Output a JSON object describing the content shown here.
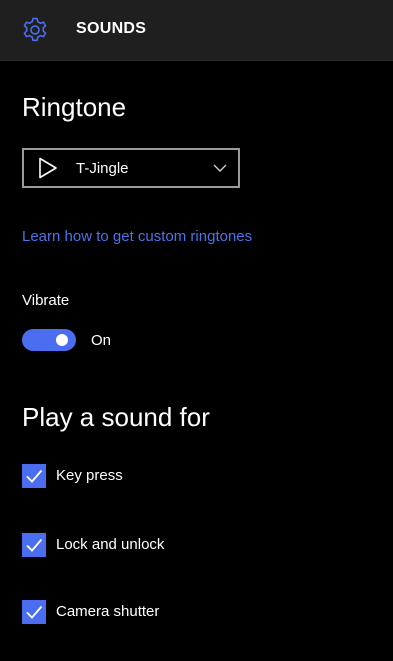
{
  "header": {
    "icon": "gear-icon",
    "title": "SOUNDS"
  },
  "ringtone": {
    "heading": "Ringtone",
    "selected": "T-Jingle",
    "play_icon": "play-icon",
    "dropdown_icon": "chevron-down-icon",
    "custom_link": "Learn how to get custom ringtones"
  },
  "vibrate": {
    "label": "Vibrate",
    "state": "On"
  },
  "play_sound": {
    "heading": "Play a sound for",
    "items": [
      {
        "label": "Key press",
        "checked": true
      },
      {
        "label": "Lock and unlock",
        "checked": true
      },
      {
        "label": "Camera shutter",
        "checked": true
      }
    ]
  },
  "colors": {
    "accent": "#4b6ef0",
    "link": "#4f73e8",
    "background": "#000000",
    "header": "#1f1f1f"
  }
}
